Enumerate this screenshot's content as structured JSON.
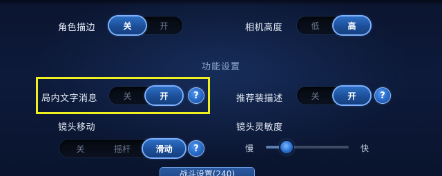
{
  "settings": {
    "outline": {
      "label": "角色描边",
      "options": [
        "关",
        "开"
      ],
      "selected": 0
    },
    "camera_height": {
      "label": "相机高度",
      "options": [
        "低",
        "高"
      ],
      "selected": 1
    },
    "section_title": "功能设置",
    "ingame_text": {
      "label": "局内文字消息",
      "options": [
        "关",
        "开"
      ],
      "selected": 1
    },
    "recommend_desc": {
      "label": "推荐装描述",
      "options": [
        "关",
        "开"
      ],
      "selected": 1
    },
    "camera_move": {
      "label": "镜头移动",
      "options": [
        "关",
        "摇杆",
        "滑动"
      ],
      "selected": 2
    },
    "camera_sensitivity": {
      "label": "镜头灵敏度",
      "min_label": "慢",
      "max_label": "快",
      "value": 0.25
    }
  },
  "help_symbol": "?",
  "bottom_tab": {
    "label": "战斗设置(240)"
  },
  "colors": {
    "highlight": "#f0f020",
    "accent": "#2d6fc4"
  }
}
